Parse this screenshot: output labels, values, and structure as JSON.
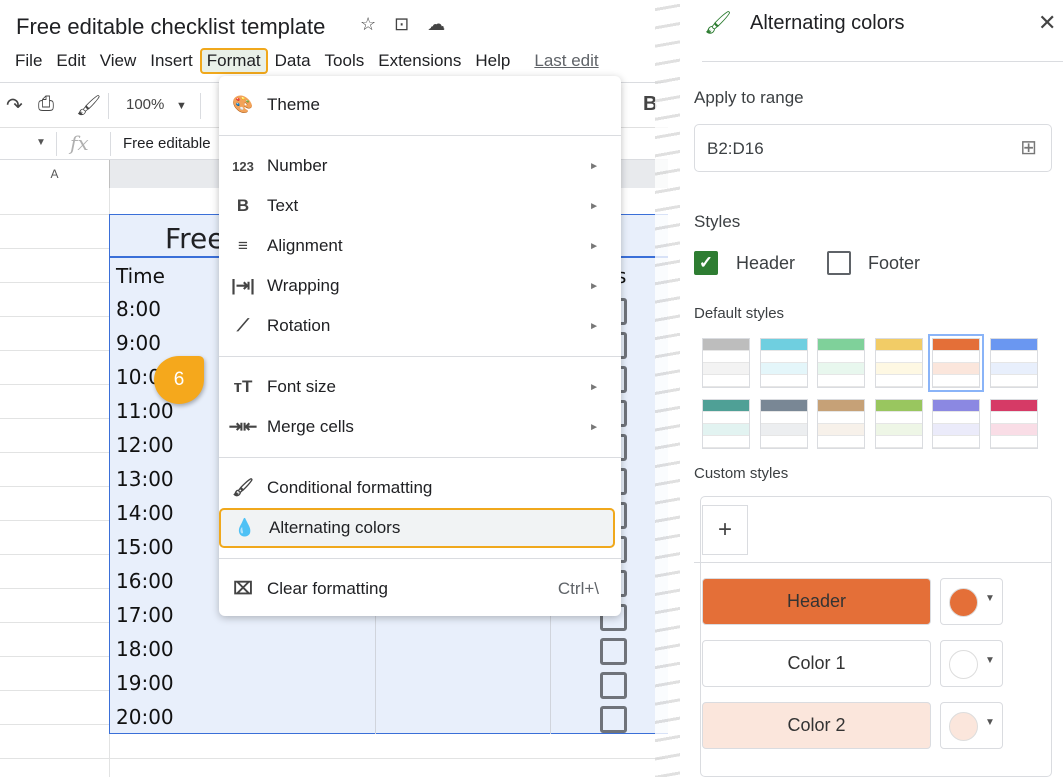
{
  "app": {
    "doc_title": "Free editable checklist template",
    "title_icons": [
      "star-icon",
      "move-to-folder-icon",
      "cloud-saved-icon"
    ]
  },
  "menubar": {
    "items": [
      "File",
      "Edit",
      "View",
      "Insert",
      "Format",
      "Data",
      "Tools",
      "Extensions",
      "Help"
    ],
    "active": "Format",
    "last_edit": "Last edit"
  },
  "toolbar": {
    "zoom": "100%",
    "bold_label": "B"
  },
  "formula_bar": {
    "fx": "fx",
    "content": "Free editable"
  },
  "sheet": {
    "column_a": "A",
    "title_cell_visible": "Free",
    "header_time": "Time",
    "header_status_partial": "s",
    "times": [
      "8:00",
      "9:00",
      "10:00",
      "11:00",
      "12:00",
      "13:00",
      "14:00",
      "15:00",
      "16:00",
      "17:00",
      "18:00",
      "19:00",
      "20:00"
    ],
    "selection_color": "#e8effb"
  },
  "step_badge": "6",
  "format_menu": {
    "items": [
      {
        "label": "Theme",
        "icon": "palette-icon",
        "submenu": false
      },
      {
        "label": "Number",
        "icon": "number-123-icon",
        "submenu": true
      },
      {
        "label": "Text",
        "icon": "bold-icon",
        "submenu": true
      },
      {
        "label": "Alignment",
        "icon": "align-left-icon",
        "submenu": true
      },
      {
        "label": "Wrapping",
        "icon": "wrap-icon",
        "submenu": true
      },
      {
        "label": "Rotation",
        "icon": "rotation-icon",
        "submenu": true
      },
      {
        "label": "Font size",
        "icon": "font-size-icon",
        "submenu": true
      },
      {
        "label": "Merge cells",
        "icon": "merge-icon",
        "submenu": true
      },
      {
        "label": "Conditional formatting",
        "icon": "paint-roller-icon",
        "submenu": false
      },
      {
        "label": "Alternating colors",
        "icon": "droplet-icon",
        "submenu": false,
        "highlighted": true
      },
      {
        "label": "Clear formatting",
        "icon": "clear-format-icon",
        "submenu": false,
        "shortcut": "Ctrl+\\"
      }
    ]
  },
  "panel": {
    "title": "Alternating colors",
    "apply_to_range_label": "Apply to range",
    "range_value": "B2:D16",
    "styles_label": "Styles",
    "header_checkbox": {
      "label": "Header",
      "checked": true
    },
    "footer_checkbox": {
      "label": "Footer",
      "checked": false
    },
    "default_styles_label": "Default styles",
    "default_styles": [
      {
        "header": "#bdbdbd",
        "alt": "#f3f3f3"
      },
      {
        "header": "#6fcfe0",
        "alt": "#e4f6fa"
      },
      {
        "header": "#7fd19a",
        "alt": "#e8f7ee"
      },
      {
        "header": "#f2cc66",
        "alt": "#fef8e3"
      },
      {
        "header": "#e46f38",
        "alt": "#fbe6dc",
        "selected": true
      },
      {
        "header": "#6a97f1",
        "alt": "#e8effc"
      },
      {
        "header": "#4fa096",
        "alt": "#e2f3f1"
      },
      {
        "header": "#798795",
        "alt": "#eceef0"
      },
      {
        "header": "#c6a177",
        "alt": "#f7f1ea"
      },
      {
        "header": "#99c65f",
        "alt": "#eef6e6"
      },
      {
        "header": "#8b88e2",
        "alt": "#ebebfa"
      },
      {
        "header": "#d63a66",
        "alt": "#f9dde6"
      }
    ],
    "custom_styles_label": "Custom styles",
    "add_label": "+",
    "custom_colors": [
      {
        "label": "Header",
        "color": "#e46f38"
      },
      {
        "label": "Color 1",
        "color": "#ffffff"
      },
      {
        "label": "Color 2",
        "color": "#fbe6dc"
      }
    ]
  }
}
